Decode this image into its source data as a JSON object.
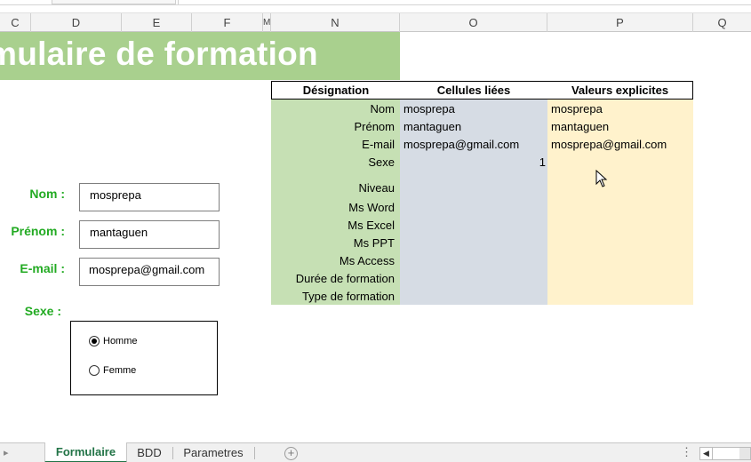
{
  "columns": [
    "C",
    "D",
    "E",
    "F",
    "M",
    "N",
    "O",
    "P",
    "Q"
  ],
  "banner_title": "mulaire de formation",
  "table": {
    "headers": [
      "Désignation",
      "Cellules liées",
      "Valeurs explicites"
    ],
    "labels": [
      "Nom",
      "Prénom",
      "E-mail",
      "Sexe",
      "Niveau",
      "Ms Word",
      "Ms Excel",
      "Ms PPT",
      "Ms Access",
      "Durée de formation",
      "Type de formation"
    ],
    "linked_values": [
      "mosprepa",
      "mantaguen",
      "mosprepa@gmail.com",
      "1"
    ],
    "explicit_values": [
      "mosprepa",
      "mantaguen",
      "mosprepa@gmail.com"
    ],
    "colors": {
      "designation": "#c6e0b4",
      "linked": "#d6dce4",
      "explicit": "#fff2cc"
    }
  },
  "form": {
    "nom_label": "Nom :",
    "nom_value": "mosprepa",
    "prenom_label": "Prénom :",
    "prenom_value": "mantaguen",
    "email_label": "E-mail :",
    "email_value": "mosprepa@gmail.com",
    "sexe_label": "Sexe :",
    "radio_options": [
      "Homme",
      "Femme"
    ],
    "selected_option": "Homme",
    "label_color": "#22aa22"
  },
  "sheet_tabs": [
    "Formulaire",
    "BDD",
    "Parametres"
  ],
  "active_tab": "Formulaire",
  "add_sheet_symbol": "+",
  "brand_color": "#217346",
  "banner_color": "#a9d08e"
}
